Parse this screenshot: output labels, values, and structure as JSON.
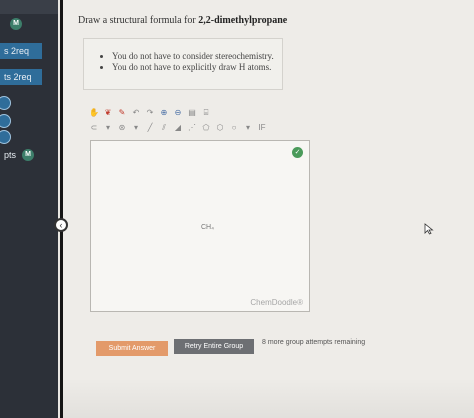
{
  "sidebar": {
    "items": [
      {
        "label": "s  2req",
        "style": "blue"
      },
      {
        "label": "ts  2req",
        "style": "blue"
      },
      {
        "label": "pts",
        "style": "plain"
      }
    ],
    "badge_label": "M"
  },
  "question": {
    "prefix": "Draw a structural formula for ",
    "compound": "2,2-dimethylpropane"
  },
  "notes": [
    "You do not have to consider stereochemistry.",
    "You do not have to explicitly draw H atoms."
  ],
  "canvas": {
    "molecule_label": "CH₄",
    "brand": "ChemDoodle®"
  },
  "actions": {
    "submit_label": "Submit Answer",
    "retry_label": "Retry Entire Group",
    "attempts_text": "8 more group attempts remaining"
  },
  "colors": {
    "sidebar_bg": "#2c3038",
    "submit_bg": "#e39a6a",
    "retry_bg": "#6d6f73",
    "accent_blue": "#2f6d9a"
  }
}
